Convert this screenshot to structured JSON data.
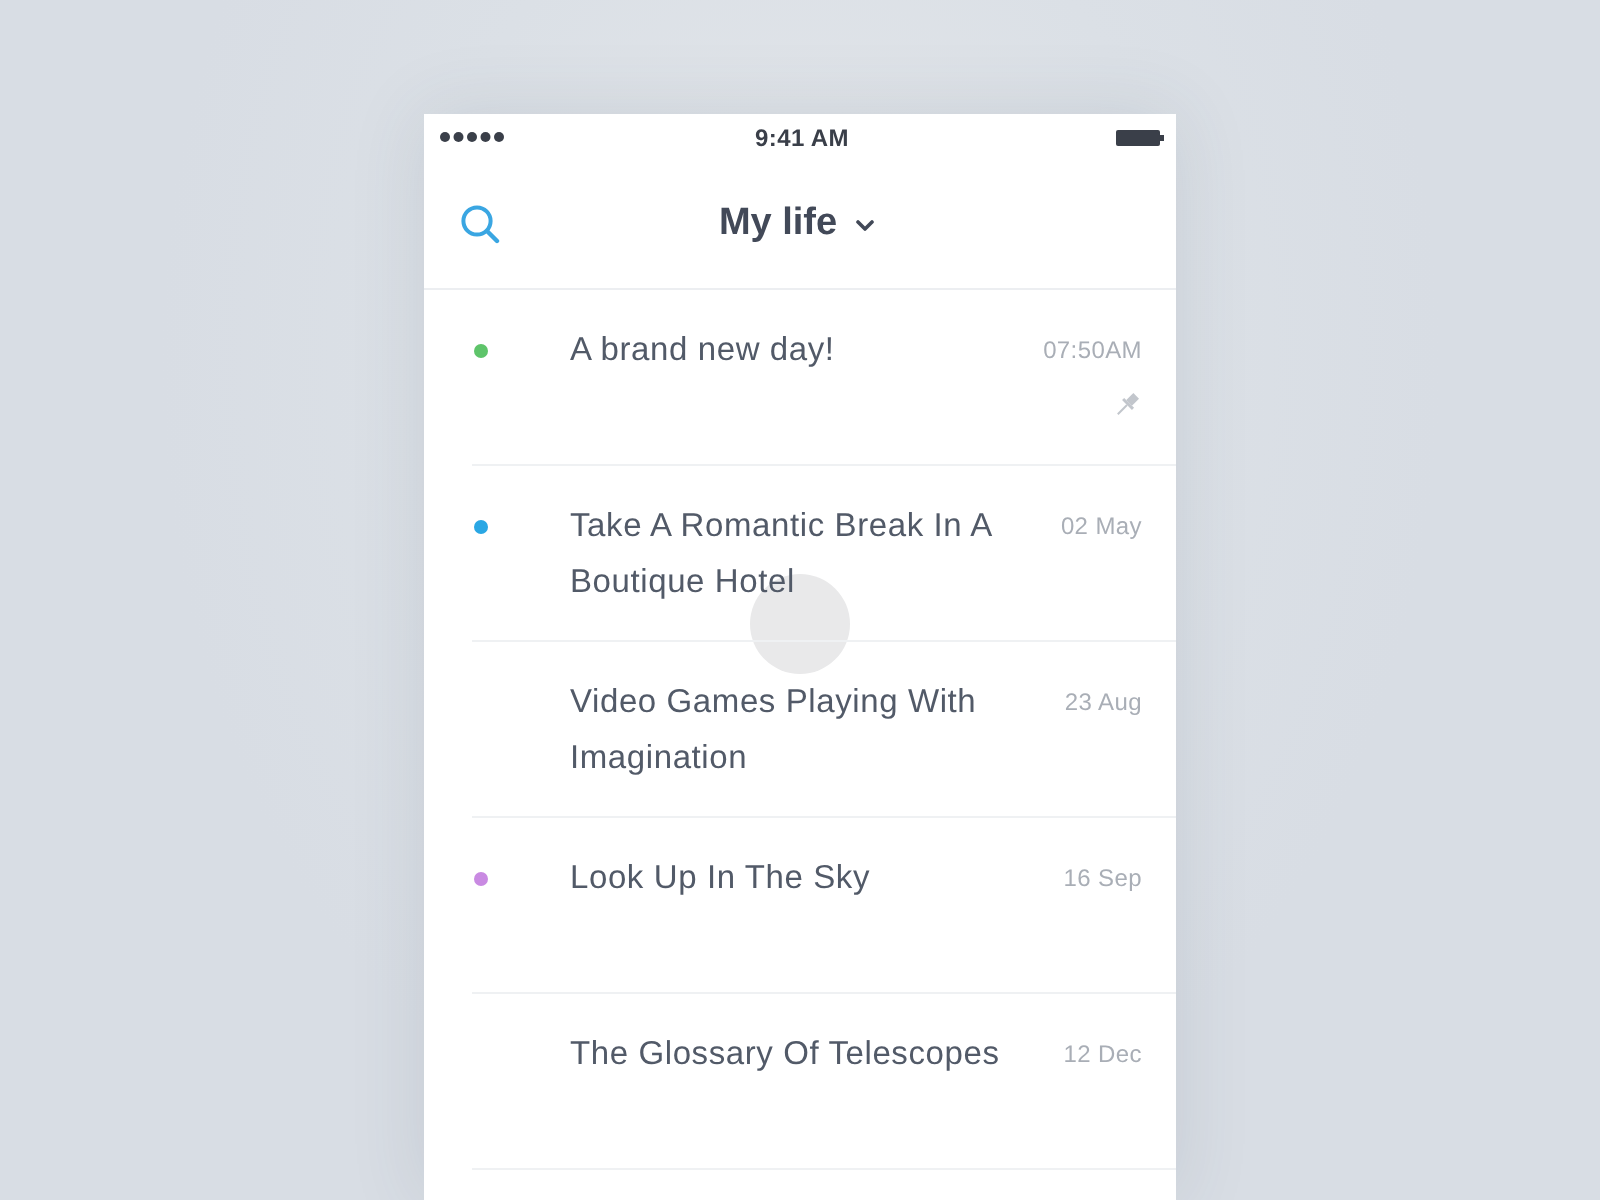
{
  "status_bar": {
    "time": "9:41 AM"
  },
  "header": {
    "title": "My life"
  },
  "notes": [
    {
      "title": "A brand new day!",
      "time": "07:50AM",
      "color": "#5ec46a",
      "pinned": true
    },
    {
      "title": "Take A Romantic Break In A Boutique Hotel",
      "time": "02 May",
      "color": "#2aa7e4",
      "pinned": false
    },
    {
      "title": "Video Games Playing With Imagination",
      "time": "23 Aug",
      "pinned": false
    },
    {
      "title": "Look Up In The Sky",
      "time": "16 Sep",
      "color": "#c98ae2",
      "pinned": false
    },
    {
      "title": "The Glossary Of Telescopes",
      "time": "12 Dec",
      "pinned": false
    }
  ]
}
